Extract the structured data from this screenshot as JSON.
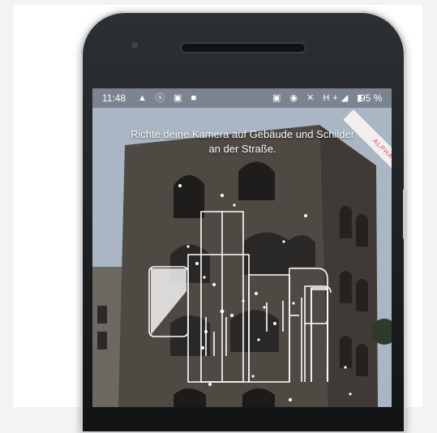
{
  "status_bar": {
    "time": "11:48",
    "left_icons": [
      "navigation-icon",
      "whatsapp-icon",
      "message-icon",
      "video-icon"
    ],
    "left_glyphs": "▲ ⓢ ▣ ■",
    "right_icons": [
      "cast-icon",
      "location-icon",
      "mute-icon",
      "signal-icon",
      "battery-icon"
    ],
    "right_glyphs": "▣ ◉ ✕ H+◢ ▮",
    "battery": "95 %"
  },
  "ribbon": {
    "label": "ALPHA"
  },
  "instruction": {
    "text": "Richte deine Kamera auf Gebäude und Schilder an der Straße."
  },
  "colors": {
    "overlay_stroke": "#ffffff",
    "sky": "#b9c3cf",
    "building": "#4d4741",
    "ribbon_text": "#d04a4a"
  }
}
